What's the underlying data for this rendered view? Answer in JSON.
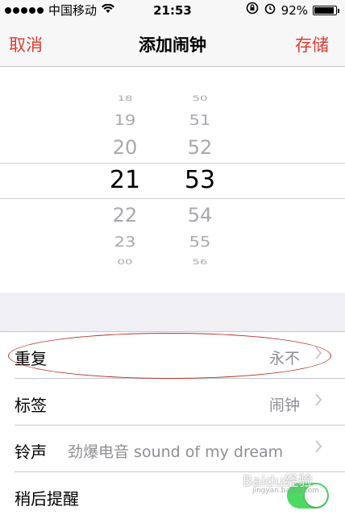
{
  "status_bar": {
    "carrier": "中国移动",
    "time": "21:53",
    "battery_percent": "92%",
    "battery_level": 0.92,
    "icons": [
      "signal-dots-icon",
      "wifi-icon",
      "rotation-lock-icon",
      "alarm-icon",
      "battery-icon"
    ]
  },
  "nav": {
    "cancel": "取消",
    "title": "添加闹钟",
    "save": "存储",
    "accent": "#e23b2f"
  },
  "picker": {
    "hours": [
      "18",
      "19",
      "20",
      "21",
      "22",
      "23",
      "00"
    ],
    "minutes": [
      "50",
      "51",
      "52",
      "53",
      "54",
      "55",
      "56"
    ],
    "selected_hour": "21",
    "selected_minute": "53"
  },
  "settings": {
    "repeat": {
      "label": "重复",
      "value": "永不"
    },
    "label": {
      "label": "标签",
      "value": "闹钟"
    },
    "sound": {
      "label": "铃声",
      "value": "劲爆电音 sound of my dream"
    },
    "snooze": {
      "label": "稍后提醒",
      "enabled": true
    }
  },
  "watermark": {
    "text": "Baidu经验",
    "sub": "jingyan.baidu.com"
  },
  "toggle_color": "#4cd964"
}
